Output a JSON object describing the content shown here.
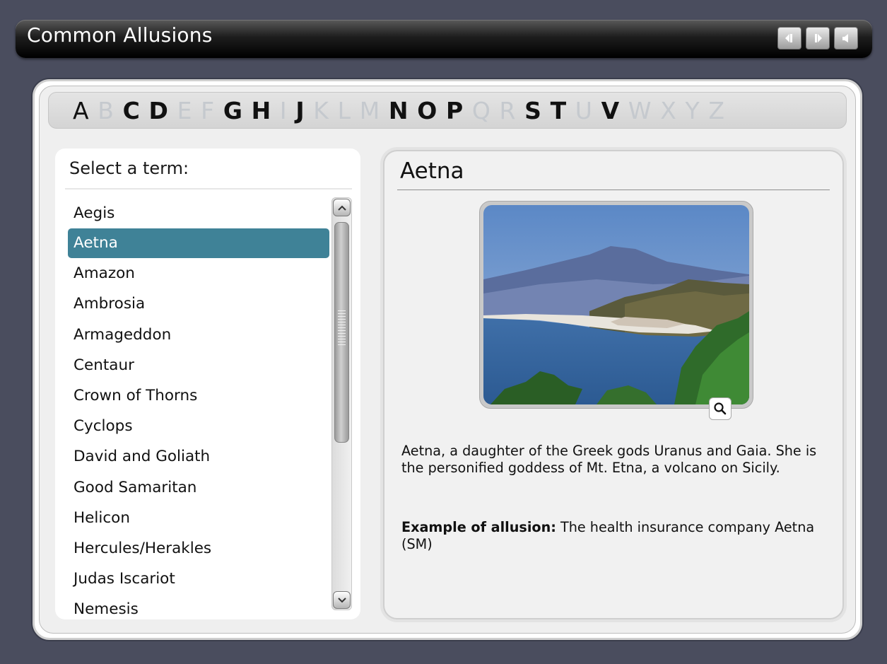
{
  "app": {
    "title": "Common Allusions",
    "buttons": [
      {
        "name": "previous",
        "icon": "previous-icon"
      },
      {
        "name": "next",
        "icon": "next-icon"
      },
      {
        "name": "audio",
        "icon": "speaker-icon"
      }
    ]
  },
  "alphabet": [
    {
      "letter": "A",
      "active": true
    },
    {
      "letter": "B",
      "active": false
    },
    {
      "letter": "C",
      "active": true
    },
    {
      "letter": "D",
      "active": true
    },
    {
      "letter": "E",
      "active": false
    },
    {
      "letter": "F",
      "active": false
    },
    {
      "letter": "G",
      "active": true
    },
    {
      "letter": "H",
      "active": true
    },
    {
      "letter": "I",
      "active": false
    },
    {
      "letter": "J",
      "active": true
    },
    {
      "letter": "K",
      "active": false
    },
    {
      "letter": "L",
      "active": false
    },
    {
      "letter": "M",
      "active": false
    },
    {
      "letter": "N",
      "active": true
    },
    {
      "letter": "O",
      "active": true
    },
    {
      "letter": "P",
      "active": true
    },
    {
      "letter": "Q",
      "active": false
    },
    {
      "letter": "R",
      "active": false
    },
    {
      "letter": "S",
      "active": true
    },
    {
      "letter": "T",
      "active": true
    },
    {
      "letter": "U",
      "active": false
    },
    {
      "letter": "V",
      "active": true
    },
    {
      "letter": "W",
      "active": false
    },
    {
      "letter": "X",
      "active": false
    },
    {
      "letter": "Y",
      "active": false
    },
    {
      "letter": "Z",
      "active": false
    }
  ],
  "terms": {
    "heading": "Select a term:",
    "selected": "Aetna",
    "items": [
      "Aegis",
      "Aetna",
      "Amazon",
      "Ambrosia",
      "Armageddon",
      "Centaur",
      "Crown of Thorns",
      "Cyclops",
      "David and Goliath",
      "Good Samaritan",
      "Helicon",
      "Hercules/Herakles",
      "Judas Iscariot",
      "Nemesis"
    ]
  },
  "detail": {
    "title": "Aetna",
    "description": "Aetna, a daughter of the Greek gods Uranus and Gaia. She is the personified goddess of Mt. Etna, a volcano on Sicily.",
    "example_label": "Example of allusion:",
    "example_text": " The health insurance company Aetna (SM)",
    "zoom_icon": "magnifier-icon"
  },
  "colors": {
    "background": "#4a4d5e",
    "selection": "#3f8297",
    "inactive_letter": "#c5c9ce"
  }
}
